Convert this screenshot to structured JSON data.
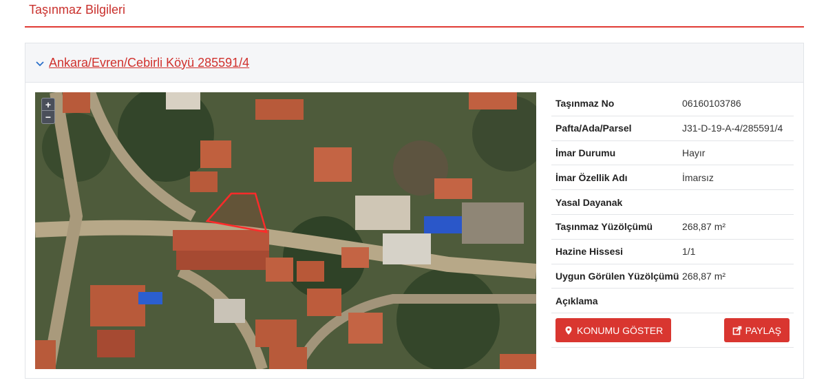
{
  "page": {
    "title": "Taşınmaz Bilgileri"
  },
  "panel": {
    "heading_link": "Ankara/Evren/Cebirli Köyü 285591/4"
  },
  "map": {
    "zoom_in": "+",
    "zoom_out": "−"
  },
  "info": {
    "rows": [
      {
        "label": "Taşınmaz No",
        "value": "06160103786"
      },
      {
        "label": "Pafta/Ada/Parsel",
        "value": "J31-D-19-A-4/285591/4"
      },
      {
        "label": "İmar Durumu",
        "value": "Hayır"
      },
      {
        "label": "İmar Özellik Adı",
        "value": "İmarsız"
      },
      {
        "label": "Yasal Dayanak",
        "value": ""
      },
      {
        "label": "Taşınmaz Yüzölçümü",
        "value": "268,87 m²"
      },
      {
        "label": "Hazine Hissesi",
        "value": "1/1"
      },
      {
        "label": "Uygun Görülen Yüzölçümü",
        "value": "268,87 m²"
      },
      {
        "label": "Açıklama",
        "value": ""
      }
    ]
  },
  "actions": {
    "show_location": "KONUMU GÖSTER",
    "share": "PAYLAŞ"
  },
  "colors": {
    "accent": "#d93630",
    "parcel_outline": "#ff2a2a"
  }
}
